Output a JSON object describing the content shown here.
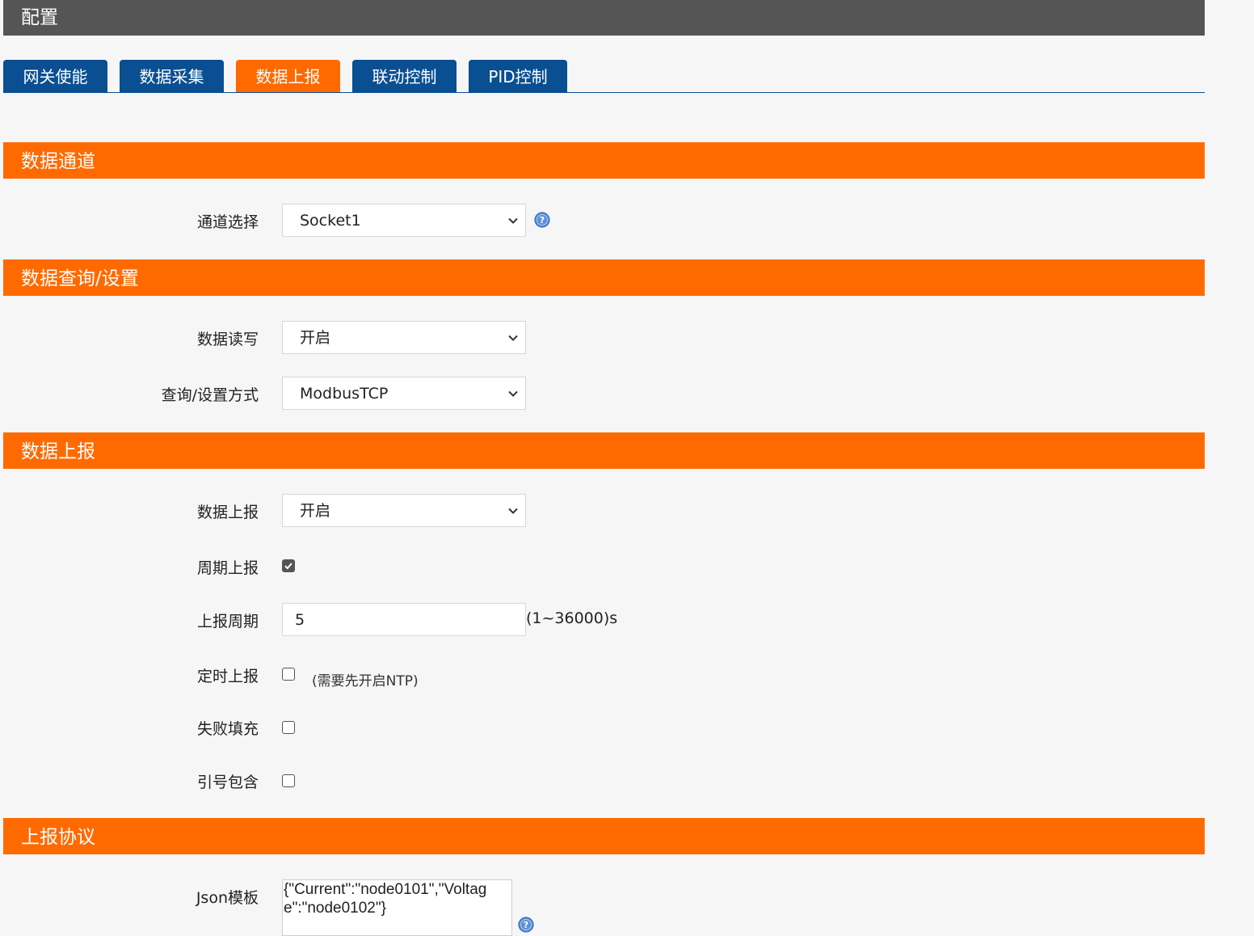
{
  "header": {
    "title": "配置"
  },
  "tabs": [
    {
      "label": "网关使能",
      "active": false
    },
    {
      "label": "数据采集",
      "active": false
    },
    {
      "label": "数据上报",
      "active": true
    },
    {
      "label": "联动控制",
      "active": false
    },
    {
      "label": "PID控制",
      "active": false
    }
  ],
  "sections": {
    "channel": {
      "title": "数据通道",
      "channel_select_label": "通道选择",
      "channel_select_value": "Socket1"
    },
    "query": {
      "title": "数据查询/设置",
      "rw_label": "数据读写",
      "rw_value": "开启",
      "method_label": "查询/设置方式",
      "method_value": "ModbusTCP"
    },
    "report": {
      "title": "数据上报",
      "report_label": "数据上报",
      "report_value": "开启",
      "periodic_label": "周期上报",
      "periodic_checked": true,
      "period_label": "上报周期",
      "period_value": "5",
      "period_unit": "(1~36000)s",
      "timed_label": "定时上报",
      "timed_checked": false,
      "timed_hint": "(需要先开启NTP)",
      "fail_fill_label": "失败填充",
      "fail_fill_checked": false,
      "quote_label": "引号包含",
      "quote_checked": false
    },
    "protocol": {
      "title": "上报协议",
      "json_label": "Json模板",
      "json_value": "{\"Current\":\"node0101\",\"Voltage\":\"node0102\"}"
    }
  },
  "colors": {
    "accent": "#ff6a00",
    "tab_blue": "#0a4f91",
    "topbar": "#555555",
    "background": "#f6f6f6"
  },
  "icons": {
    "help": "question-circle-icon",
    "dropdown": "chevron-down-icon",
    "check": "checkmark-icon"
  }
}
